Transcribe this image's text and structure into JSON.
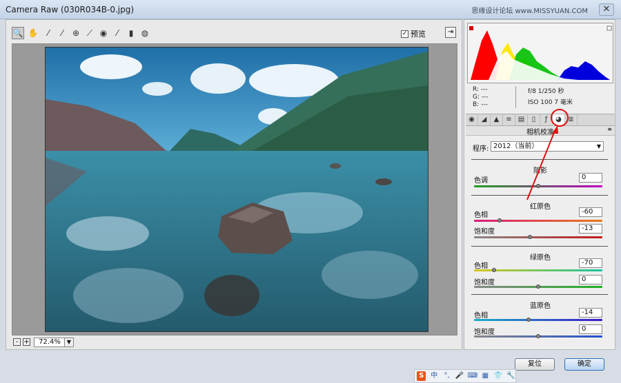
{
  "window": {
    "title": "Camera Raw (030R034B-0.jpg)",
    "watermark": "思缘设计论坛 www.MISSYUAN.COM",
    "close_icon": "close-icon"
  },
  "toolbar": {
    "tools": [
      "zoom-icon",
      "hand-icon",
      "white-balance-icon",
      "color-sampler-icon",
      "target-adjust-icon",
      "crop-icon",
      "spot-removal-icon",
      "red-eye-icon",
      "brush-icon",
      "graduated-filter-icon",
      "radial-filter-icon"
    ],
    "preview_label": "预览",
    "preview_checked": true
  },
  "zoom": {
    "minus": "-",
    "plus": "+",
    "value": "72.4%"
  },
  "info": {
    "r": "R:  ---",
    "g": "G:  ---",
    "b": "B:  ---",
    "exposure": "f/8   1/250 秒",
    "iso": "ISO 100   7 毫米"
  },
  "panel": {
    "title": "相机校准",
    "program_label": "程序:",
    "program_value": "2012（当前）",
    "shadows": {
      "title": "阴影",
      "tint_label": "色调",
      "tint_value": "0"
    },
    "red": {
      "title": "红原色",
      "hue_label": "色相",
      "hue_value": "-60",
      "sat_label": "饱和度",
      "sat_value": "-13"
    },
    "green": {
      "title": "绿原色",
      "hue_label": "色相",
      "hue_value": "-70",
      "sat_label": "饱和度",
      "sat_value": "0"
    },
    "blue": {
      "title": "蓝原色",
      "hue_label": "色相",
      "hue_value": "-14",
      "sat_label": "饱和度",
      "sat_value": "0"
    }
  },
  "buttons": {
    "reset": "复位",
    "ok": "确定"
  },
  "taskbar": {
    "ime_cn": "中"
  }
}
